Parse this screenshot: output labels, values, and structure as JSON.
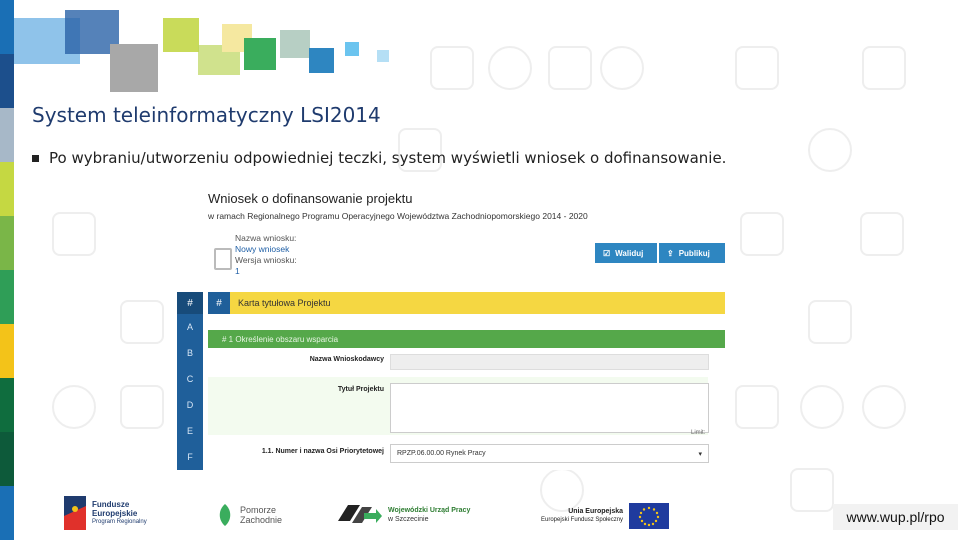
{
  "slide": {
    "title": "System teleinformatyczny LSI2014",
    "bullet": "Po wybraniu/utworzeniu odpowiedniej teczki, system wyświetli wniosek o dofinansowanie.",
    "url": "www.wup.pl/rpo",
    "strip_colors": [
      "#1a6fb5",
      "#1c4f8c",
      "#a7b8c8",
      "#c5d842",
      "#7ab648",
      "#2f9e57",
      "#f3c319",
      "#0f6d3e",
      "#0d5a3a",
      "#1a6fb5"
    ]
  },
  "app": {
    "title": "Wniosek o dofinansowanie projektu",
    "subtitle": "w ramach Regionalnego Programu Operacyjnego Województwa Zachodniopomorskiego 2014 - 2020",
    "meta": {
      "name_label": "Nazwa wniosku:",
      "name_value": "Nowy wniosek",
      "version_label": "Wersja wniosku:",
      "version_value": "1"
    },
    "buttons": {
      "validate": "Waliduj",
      "publish": "Publikuj"
    },
    "sidebar": {
      "hash": "#",
      "letters": [
        "A",
        "B",
        "C",
        "D",
        "E",
        "F"
      ]
    },
    "card": {
      "hash": "#",
      "title": "Karta tytułowa Projektu"
    },
    "section": {
      "title": "# 1   Określenie obszaru wsparcia"
    },
    "fields": {
      "applicant_label": "Nazwa Wnioskodawcy",
      "project_title_label": "Tytuł Projektu",
      "limit_text": "Limit:",
      "priority_label": "1.1. Numer i nazwa Osi Priorytetowej",
      "priority_value": "RPZP.06.00.00 Rynek Pracy"
    }
  },
  "footer": {
    "fe": [
      "Fundusze",
      "Europejskie",
      "Program Regionalny"
    ],
    "pomorze": [
      "Pomorze",
      "Zachodnie"
    ],
    "wup": [
      "Wojewódzki Urząd Pracy",
      "w Szczecinie"
    ],
    "eu": [
      "Unia Europejska",
      "Europejski Fundusz Społeczny"
    ]
  }
}
